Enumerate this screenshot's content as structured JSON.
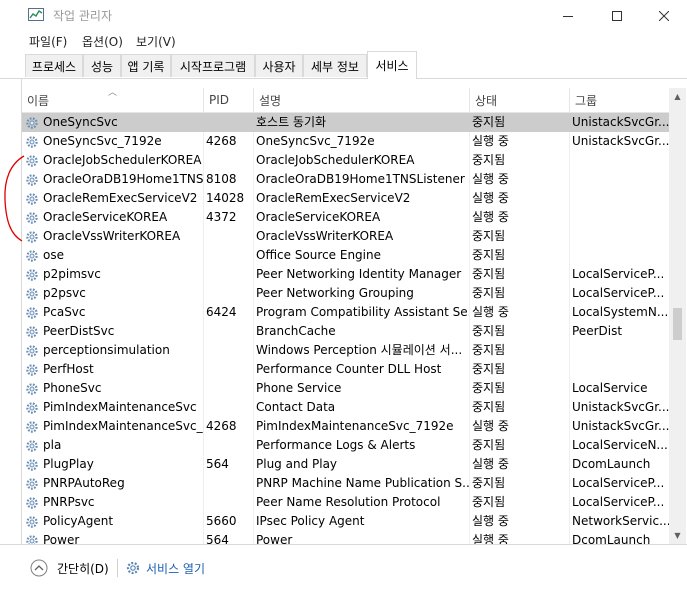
{
  "window": {
    "title": "작업 관리자",
    "icon": "taskmanager-icon"
  },
  "menu": [
    "파일(F)",
    "옵션(O)",
    "보기(V)"
  ],
  "tabs": [
    "프로세스",
    "성능",
    "앱 기록",
    "시작프로그램",
    "사용자",
    "세부 정보",
    "서비스"
  ],
  "active_tab": "서비스",
  "columns": {
    "name": "이름",
    "pid": "PID",
    "desc": "설명",
    "status": "상태",
    "group": "그룹"
  },
  "rows": [
    {
      "name": "OneSyncSvc",
      "pid": "",
      "desc": "호스트 동기화",
      "status": "중지됨",
      "group": "UnistackSvcGr..."
    },
    {
      "name": "OneSyncSvc_7192e",
      "pid": "4268",
      "desc": "OneSyncSvc_7192e",
      "status": "실행 중",
      "group": "UnistackSvcGr..."
    },
    {
      "name": "OracleJobSchedulerKOREA",
      "pid": "",
      "desc": "OracleJobSchedulerKOREA",
      "status": "중지됨",
      "group": ""
    },
    {
      "name": "OracleOraDB19Home1TNS...",
      "pid": "8108",
      "desc": "OracleOraDB19Home1TNSListener",
      "status": "실행 중",
      "group": ""
    },
    {
      "name": "OracleRemExecServiceV2",
      "pid": "14028",
      "desc": "OracleRemExecServiceV2",
      "status": "실행 중",
      "group": ""
    },
    {
      "name": "OracleServiceKOREA",
      "pid": "4372",
      "desc": "OracleServiceKOREA",
      "status": "실행 중",
      "group": ""
    },
    {
      "name": "OracleVssWriterKOREA",
      "pid": "",
      "desc": "OracleVssWriterKOREA",
      "status": "중지됨",
      "group": ""
    },
    {
      "name": "ose",
      "pid": "",
      "desc": "Office  Source Engine",
      "status": "중지됨",
      "group": ""
    },
    {
      "name": "p2pimsvc",
      "pid": "",
      "desc": "Peer Networking Identity Manager",
      "status": "중지됨",
      "group": "LocalServiceP..."
    },
    {
      "name": "p2psvc",
      "pid": "",
      "desc": "Peer Networking Grouping",
      "status": "중지됨",
      "group": "LocalServiceP..."
    },
    {
      "name": "PcaSvc",
      "pid": "6424",
      "desc": "Program Compatibility Assistant Se...",
      "status": "실행 중",
      "group": "LocalSystemN..."
    },
    {
      "name": "PeerDistSvc",
      "pid": "",
      "desc": "BranchCache",
      "status": "중지됨",
      "group": "PeerDist"
    },
    {
      "name": "perceptionsimulation",
      "pid": "",
      "desc": "Windows Perception 시뮬레이션 서...",
      "status": "중지됨",
      "group": ""
    },
    {
      "name": "PerfHost",
      "pid": "",
      "desc": "Performance Counter DLL Host",
      "status": "중지됨",
      "group": ""
    },
    {
      "name": "PhoneSvc",
      "pid": "",
      "desc": "Phone Service",
      "status": "중지됨",
      "group": "LocalService"
    },
    {
      "name": "PimIndexMaintenanceSvc",
      "pid": "",
      "desc": "Contact Data",
      "status": "중지됨",
      "group": "UnistackSvcGr..."
    },
    {
      "name": "PimIndexMaintenanceSvc_...",
      "pid": "4268",
      "desc": "PimIndexMaintenanceSvc_7192e",
      "status": "실행 중",
      "group": "UnistackSvcGr..."
    },
    {
      "name": "pla",
      "pid": "",
      "desc": "Performance Logs & Alerts",
      "status": "중지됨",
      "group": "LocalServiceN..."
    },
    {
      "name": "PlugPlay",
      "pid": "564",
      "desc": "Plug and Play",
      "status": "실행 중",
      "group": "DcomLaunch"
    },
    {
      "name": "PNRPAutoReg",
      "pid": "",
      "desc": "PNRP Machine Name Publication S...",
      "status": "중지됨",
      "group": "LocalServiceP..."
    },
    {
      "name": "PNRPsvc",
      "pid": "",
      "desc": "Peer Name Resolution Protocol",
      "status": "중지됨",
      "group": "LocalServiceP..."
    },
    {
      "name": "PolicyAgent",
      "pid": "5660",
      "desc": "IPsec Policy Agent",
      "status": "실행 중",
      "group": "NetworkServic..."
    },
    {
      "name": "Power",
      "pid": "564",
      "desc": "Power",
      "status": "실행 중",
      "group": "DcomLaunch"
    }
  ],
  "selected_row": 0,
  "footer": {
    "collapse_label": "간단히(D)",
    "open_services_label": "서비스 열기"
  },
  "colors": {
    "selected_row": "#cccccc",
    "link": "#1a5fb4",
    "annotation": "#e00000"
  }
}
